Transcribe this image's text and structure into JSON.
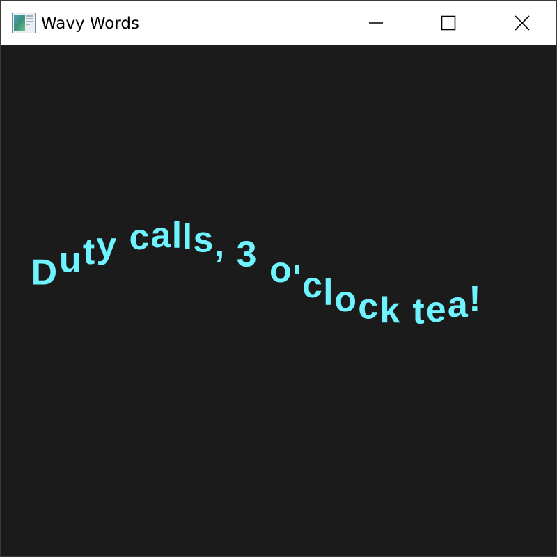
{
  "window": {
    "title": "Wavy Words",
    "icon": "app-window-icon",
    "controls": {
      "minimize": "minimize-icon",
      "maximize": "maximize-icon",
      "close": "close-icon"
    }
  },
  "canvas": {
    "background": "#1b1b1b",
    "text_color": "#6ff4ff",
    "wavy_text": "Duty calls, 3 o'clock tea!"
  }
}
